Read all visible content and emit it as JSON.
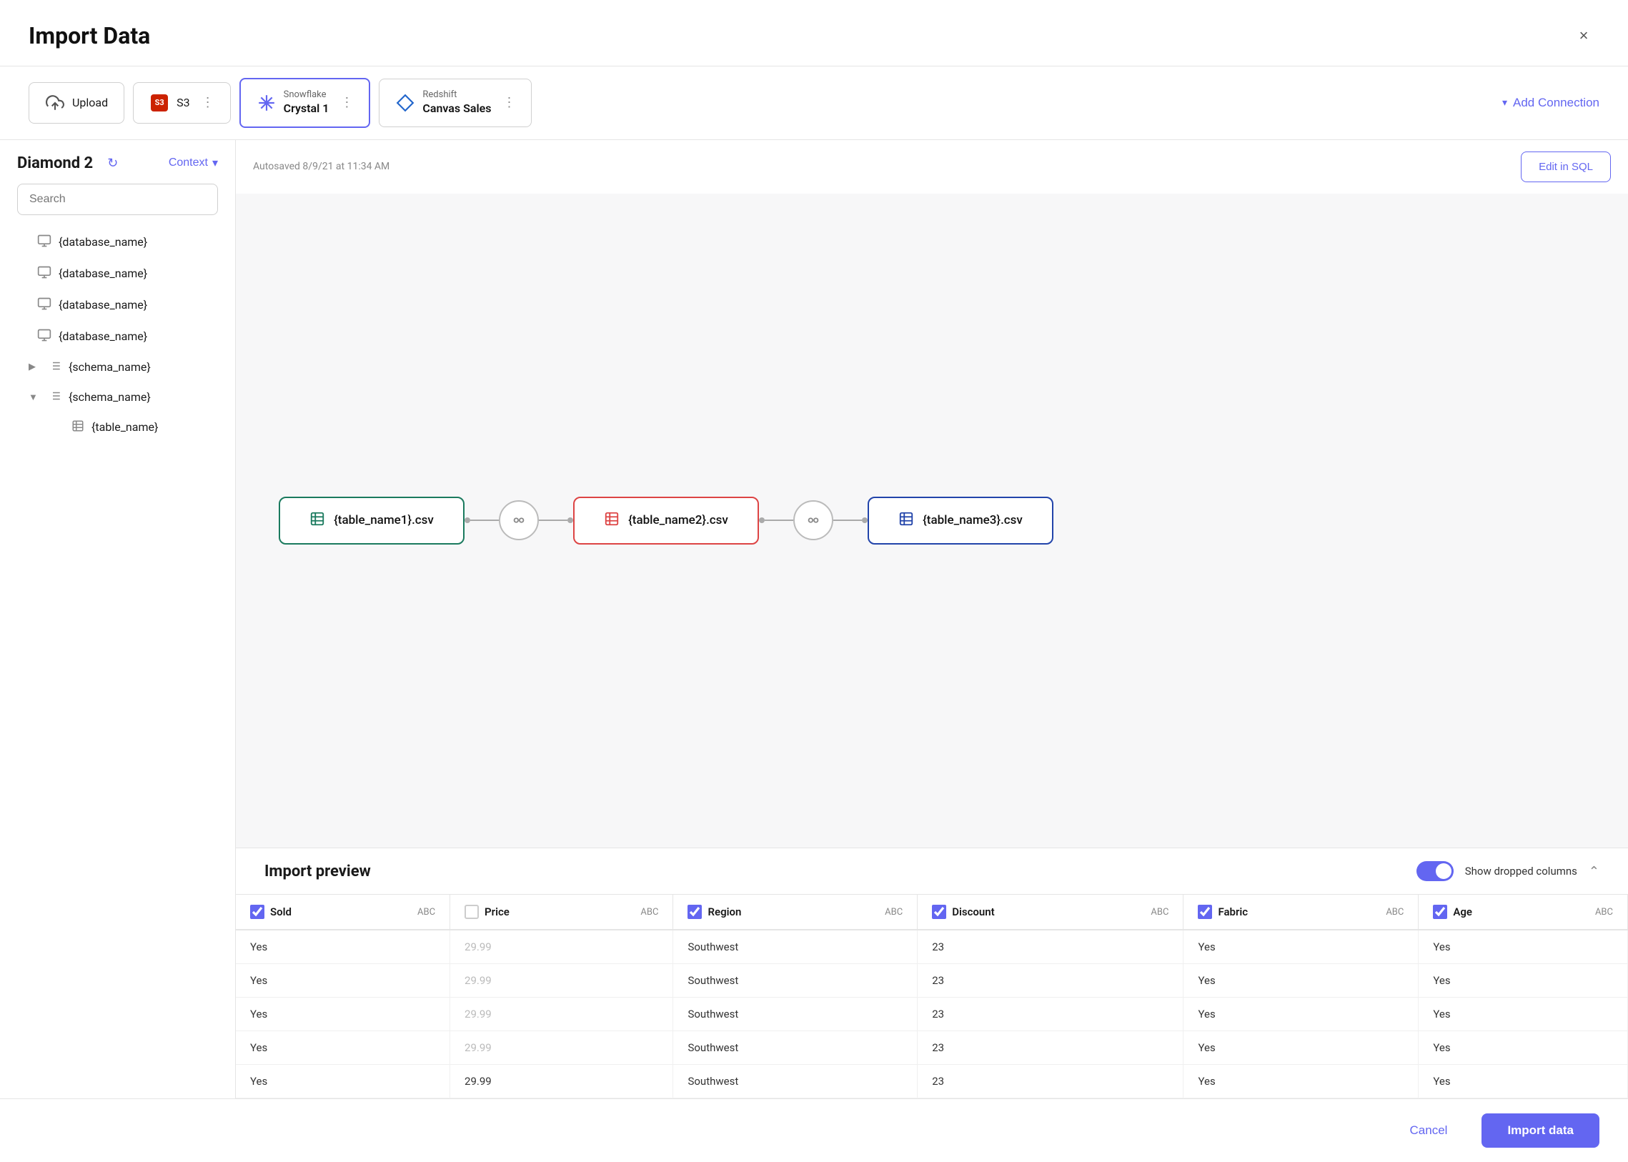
{
  "modal": {
    "title": "Import Data",
    "close_label": "×"
  },
  "connections": [
    {
      "id": "upload",
      "type": "upload",
      "label": "Upload",
      "sub": "",
      "active": false
    },
    {
      "id": "s3",
      "type": "s3",
      "label": "S3",
      "sub": "",
      "active": false
    },
    {
      "id": "snowflake",
      "type": "snowflake",
      "label": "Snowflake",
      "sub": "Crystal 1",
      "active": true
    },
    {
      "id": "redshift",
      "type": "redshift",
      "label": "Redshift",
      "sub": "Canvas Sales",
      "active": false
    }
  ],
  "add_connection_label": "Add Connection",
  "sidebar": {
    "title": "Diamond 2",
    "context_label": "Context",
    "search_placeholder": "Search",
    "databases": [
      {
        "name": "{database_name}",
        "expanded": false,
        "schemas": []
      },
      {
        "name": "{database_name}",
        "expanded": false,
        "schemas": []
      },
      {
        "name": "{database_name}",
        "expanded": false,
        "schemas": []
      },
      {
        "name": "{database_name}",
        "expanded": true,
        "schemas": [
          {
            "name": "{schema_name}",
            "expanded": false,
            "tables": []
          },
          {
            "name": "{schema_name}",
            "expanded": true,
            "tables": [
              {
                "name": "{table_name}"
              }
            ]
          }
        ]
      }
    ]
  },
  "canvas": {
    "autosave_text": "Autosaved 8/9/21 at 11:34 AM",
    "edit_sql_label": "Edit in SQL",
    "nodes": [
      {
        "id": "node1",
        "label": "{table_name1}.csv",
        "color": "green"
      },
      {
        "id": "node2",
        "label": "{table_name2}.csv",
        "color": "pink"
      },
      {
        "id": "node3",
        "label": "{table_name3}.csv",
        "color": "blue"
      }
    ]
  },
  "preview": {
    "title": "Import preview",
    "show_dropped_label": "Show dropped columns",
    "columns": [
      {
        "id": "sold",
        "name": "Sold",
        "type": "ABC",
        "checked": true
      },
      {
        "id": "price",
        "name": "Price",
        "type": "ABC",
        "checked": false
      },
      {
        "id": "region",
        "name": "Region",
        "type": "ABC",
        "checked": true
      },
      {
        "id": "discount",
        "name": "Discount",
        "type": "ABC",
        "checked": true
      },
      {
        "id": "fabric",
        "name": "Fabric",
        "type": "ABC",
        "checked": true
      },
      {
        "id": "age",
        "name": "Age",
        "type": "ABC",
        "checked": true
      }
    ],
    "rows": [
      {
        "sold": "Yes",
        "price": "29.99",
        "region": "Southwest",
        "discount": "23",
        "fabric": "Yes",
        "age": "Yes",
        "price_muted": true
      },
      {
        "sold": "Yes",
        "price": "29.99",
        "region": "Southwest",
        "discount": "23",
        "fabric": "Yes",
        "age": "Yes",
        "price_muted": true
      },
      {
        "sold": "Yes",
        "price": "29.99",
        "region": "Southwest",
        "discount": "23",
        "fabric": "Yes",
        "age": "Yes",
        "price_muted": true
      },
      {
        "sold": "Yes",
        "price": "29.99",
        "region": "Southwest",
        "discount": "23",
        "fabric": "Yes",
        "age": "Yes",
        "price_muted": true
      },
      {
        "sold": "Yes",
        "price": "29.99",
        "region": "Southwest",
        "discount": "23",
        "fabric": "Yes",
        "age": "Yes",
        "price_muted": false
      }
    ]
  },
  "footer": {
    "cancel_label": "Cancel",
    "import_label": "Import data"
  }
}
